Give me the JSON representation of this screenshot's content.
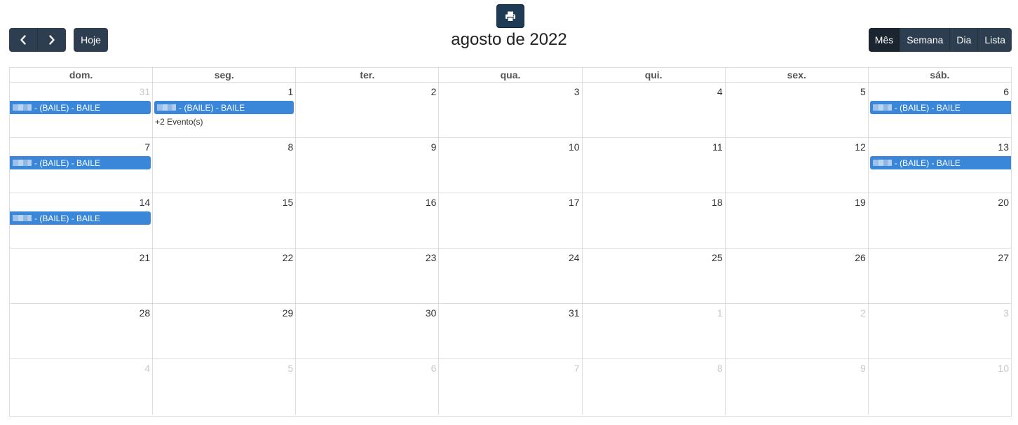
{
  "toolbar": {
    "prev_icon": "chevron-left-icon",
    "next_icon": "chevron-right-icon",
    "today_label": "Hoje",
    "title": "agosto de 2022",
    "print_icon": "print-icon",
    "views": [
      "Mês",
      "Semana",
      "Dia",
      "Lista"
    ],
    "active_view": "Mês"
  },
  "calendar": {
    "weekdays": [
      "dom.",
      "seg.",
      "ter.",
      "qua.",
      "qui.",
      "sex.",
      "sáb."
    ],
    "weeks": [
      [
        {
          "day": "31",
          "other": true,
          "event": "- (BAILE) - BAILE"
        },
        {
          "day": "1",
          "other": false,
          "event": "- (BAILE) - BAILE",
          "more": "+2 Evento(s)"
        },
        {
          "day": "2",
          "other": false
        },
        {
          "day": "3",
          "other": false
        },
        {
          "day": "4",
          "other": false
        },
        {
          "day": "5",
          "other": false
        },
        {
          "day": "6",
          "other": false,
          "event": "- (BAILE) - BAILE"
        }
      ],
      [
        {
          "day": "7",
          "other": false,
          "event": "- (BAILE) - BAILE"
        },
        {
          "day": "8",
          "other": false
        },
        {
          "day": "9",
          "other": false
        },
        {
          "day": "10",
          "other": false
        },
        {
          "day": "11",
          "other": false
        },
        {
          "day": "12",
          "other": false
        },
        {
          "day": "13",
          "other": false,
          "event": "- (BAILE) - BAILE"
        }
      ],
      [
        {
          "day": "14",
          "other": false,
          "event": "- (BAILE) - BAILE"
        },
        {
          "day": "15",
          "other": false
        },
        {
          "day": "16",
          "other": false
        },
        {
          "day": "17",
          "other": false
        },
        {
          "day": "18",
          "other": false
        },
        {
          "day": "19",
          "other": false
        },
        {
          "day": "20",
          "other": false
        }
      ],
      [
        {
          "day": "21",
          "other": false
        },
        {
          "day": "22",
          "other": false
        },
        {
          "day": "23",
          "other": false
        },
        {
          "day": "24",
          "other": false
        },
        {
          "day": "25",
          "other": false
        },
        {
          "day": "26",
          "other": false
        },
        {
          "day": "27",
          "other": false
        }
      ],
      [
        {
          "day": "28",
          "other": false
        },
        {
          "day": "29",
          "other": false
        },
        {
          "day": "30",
          "other": false
        },
        {
          "day": "31",
          "other": false
        },
        {
          "day": "1",
          "other": true
        },
        {
          "day": "2",
          "other": true
        },
        {
          "day": "3",
          "other": true
        }
      ],
      [
        {
          "day": "4",
          "other": true
        },
        {
          "day": "5",
          "other": true
        },
        {
          "day": "6",
          "other": true
        },
        {
          "day": "7",
          "other": true
        },
        {
          "day": "8",
          "other": true
        },
        {
          "day": "9",
          "other": true
        },
        {
          "day": "10",
          "other": true
        }
      ]
    ]
  },
  "colors": {
    "button": "#2c3e50",
    "button_active": "#1a252f",
    "print_button": "#1e3a54",
    "event": "#3a87d9",
    "other_month_day": "#c8c8c8"
  }
}
